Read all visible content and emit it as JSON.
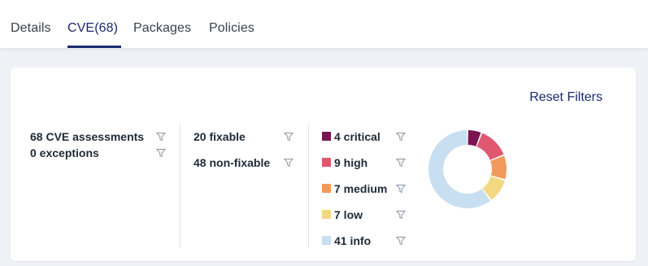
{
  "tabs": [
    {
      "label": "Details",
      "active": false
    },
    {
      "label": "CVE(68)",
      "active": true
    },
    {
      "label": "Packages",
      "active": false
    },
    {
      "label": "Policies",
      "active": false
    }
  ],
  "card": {
    "reset_label": "Reset Filters",
    "assessments": {
      "cve_label": "68 CVE assessments",
      "exceptions_label": "0 exceptions"
    },
    "fixability": {
      "fixable_label": "20 fixable",
      "nonfixable_label": "48 non-fixable"
    },
    "severity": [
      {
        "label": "4 critical",
        "count": 4,
        "color": "#7b1450"
      },
      {
        "label": "9 high",
        "count": 9,
        "color": "#e05870"
      },
      {
        "label": "7 medium",
        "count": 7,
        "color": "#f29a5b"
      },
      {
        "label": "7 low",
        "count": 7,
        "color": "#f3d984"
      },
      {
        "label": "41 info",
        "count": 41,
        "color": "#c8def1"
      }
    ]
  },
  "icons": {
    "filter": "filter-funnel-icon"
  },
  "colors": {
    "accent": "#1a2a6c",
    "background": "#eef1f6"
  }
}
